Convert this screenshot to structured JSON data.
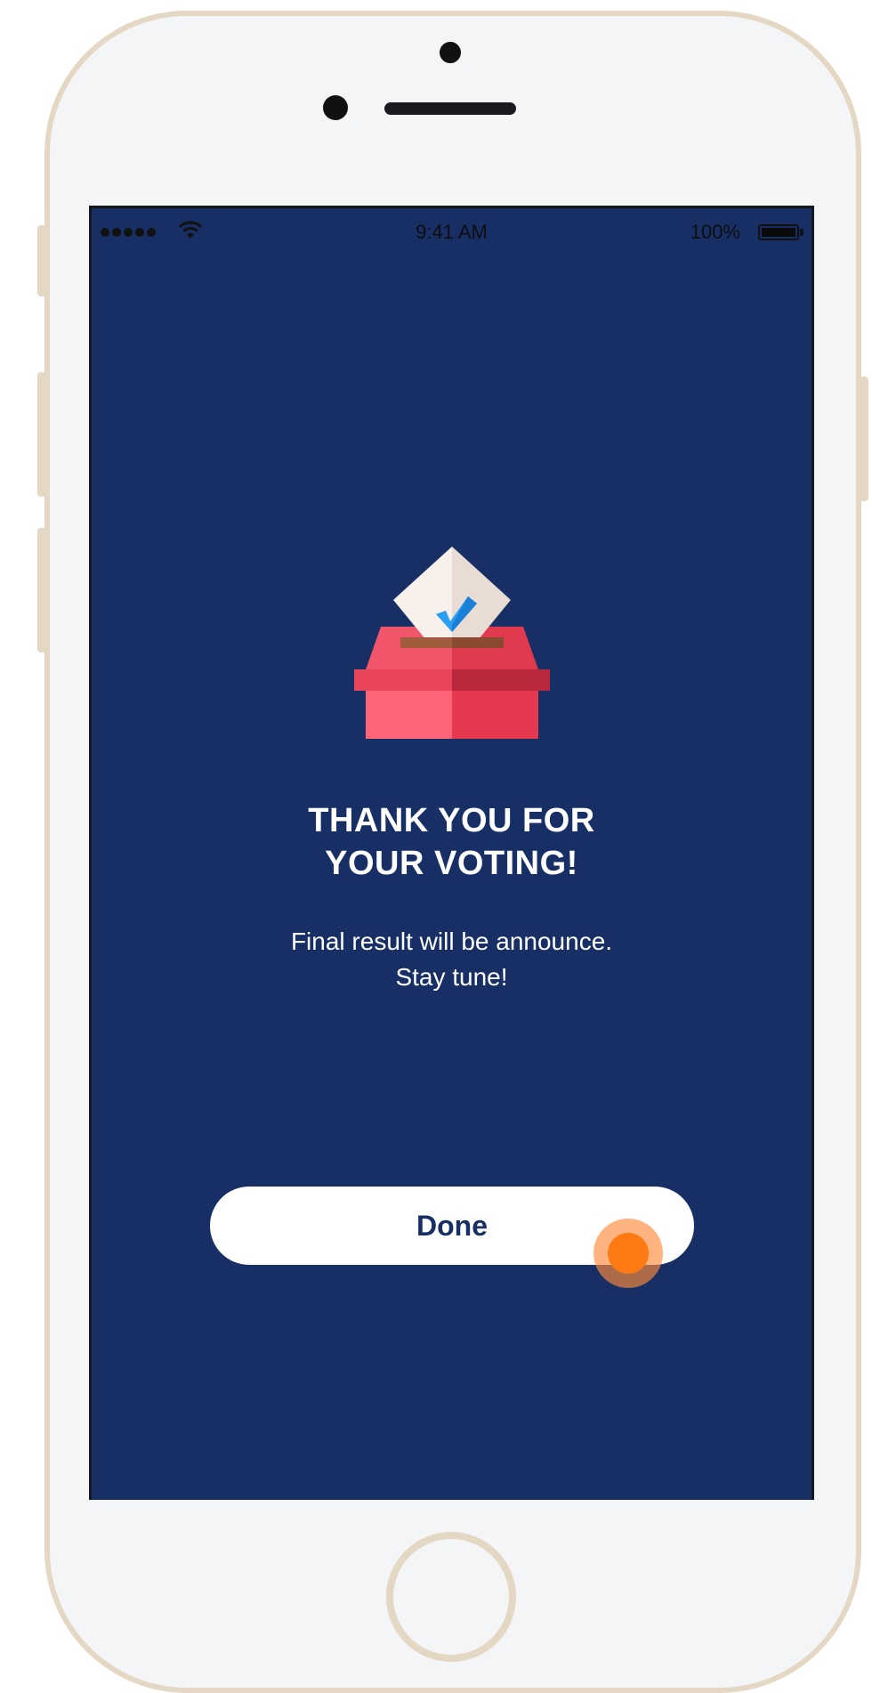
{
  "status_bar": {
    "time": "9:41 AM",
    "battery_percent": "100%",
    "signal_icon": "signal-dots-icon",
    "wifi_icon": "wifi-icon",
    "battery_icon": "battery-icon"
  },
  "illustration": {
    "icon": "ballot-box-icon"
  },
  "main": {
    "title_line1": "THANK YOU FOR",
    "title_line2": "YOUR VOTING!",
    "subtitle_line1": "Final result will be announce.",
    "subtitle_line2": "Stay tune!",
    "done_label": "Done"
  },
  "colors": {
    "background": "#172f64",
    "button": "#ffffff",
    "button_text": "#172f64",
    "touch_indicator": "#ff7a12",
    "box_red": "#f05569",
    "check_blue": "#2196f3",
    "phone_frame": "#e4d7c3"
  }
}
